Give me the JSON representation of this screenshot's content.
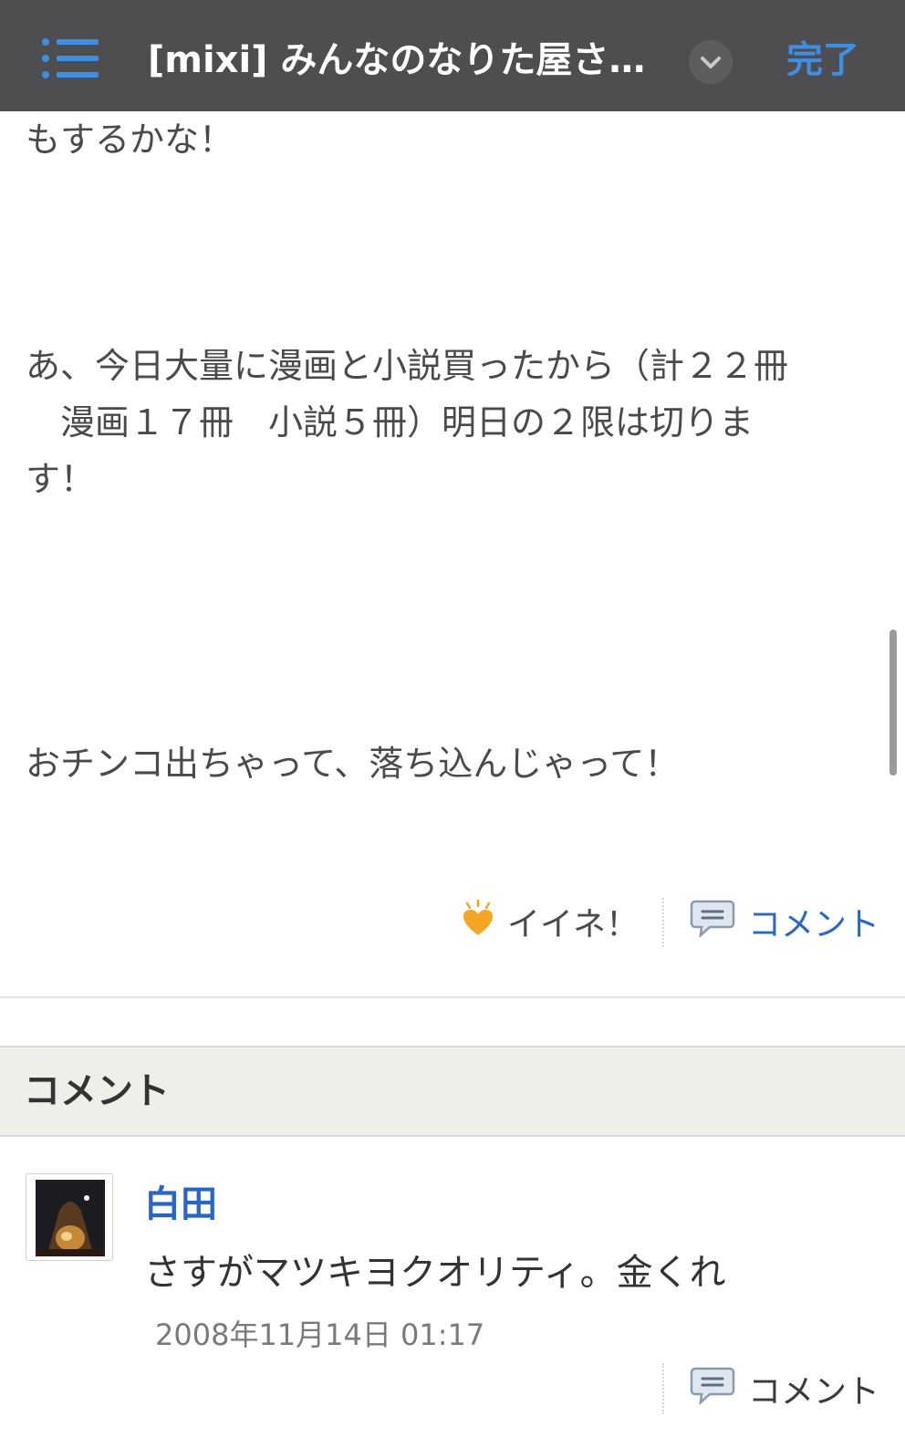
{
  "header": {
    "title": "[mixi] みんなのなりた屋さ…",
    "done_label": "完了"
  },
  "post": {
    "line1": "もするかな！",
    "para2_lines": [
      "あ、今日大量に漫画と小説買ったから（計２２冊",
      "　漫画１７冊　小説５冊）明日の２限は切りま",
      "す！"
    ],
    "line3": "おチンコ出ちゃって、落ち込んじゃって！"
  },
  "actions": {
    "like_label": "イイネ！",
    "comment_label": "コメント"
  },
  "comments": {
    "header": "コメント",
    "items": [
      {
        "author": "白田",
        "text": "さすがマツキヨクオリティ。金くれ",
        "date": "2008年11月14日 01:17",
        "comment_label": "コメント"
      }
    ]
  },
  "colors": {
    "topbar": "#4e4e50",
    "accent_blue": "#3d8fe6",
    "link_blue": "#2a66c4",
    "section_bg": "#f0eee9"
  },
  "icons": {
    "menu": "list-icon",
    "dropdown": "chevron-down-icon",
    "like": "heart-icon",
    "comment": "speech-bubble-icon"
  }
}
